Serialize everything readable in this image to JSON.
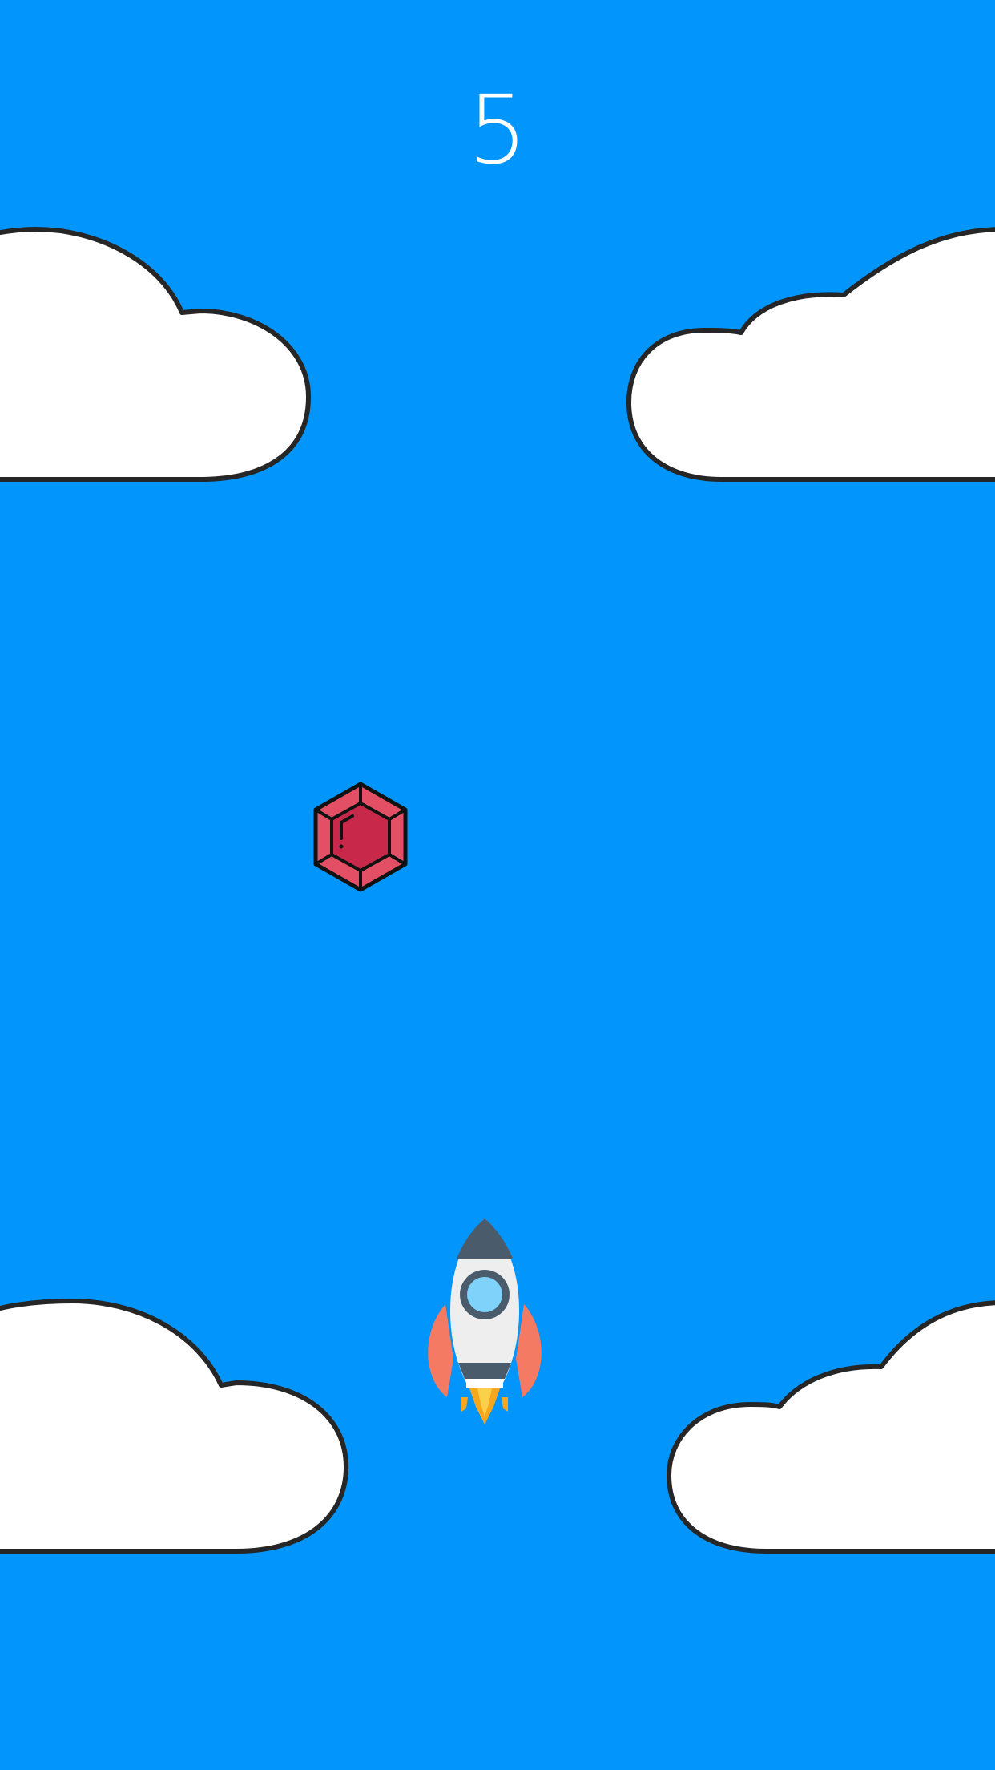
{
  "game": {
    "score": "5",
    "colors": {
      "sky": "#0295fb",
      "cloud_fill": "#ffffff",
      "cloud_outline": "#262626",
      "score_text": "#ffffff",
      "gem_fill": "#c8294a",
      "gem_facet": "#e35066",
      "rocket_body": "#eeeeee",
      "rocket_nose": "#4a5c6c",
      "rocket_window": "#7fd3fb",
      "rocket_fins": "#f47a64",
      "rocket_flame": "#f7a71c"
    },
    "sprites": {
      "player": "rocket-icon",
      "collectible": "gem-icon",
      "obstacle": "cloud-icon"
    }
  }
}
